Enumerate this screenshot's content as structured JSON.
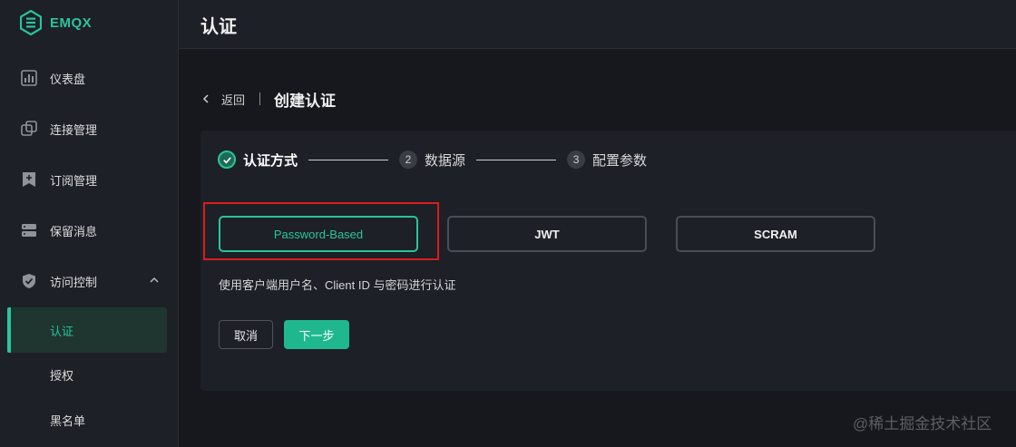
{
  "app": {
    "name": "EMQX"
  },
  "sidebar": {
    "items": [
      {
        "label": "仪表盘",
        "icon": "dashboard-icon"
      },
      {
        "label": "连接管理",
        "icon": "connections-icon"
      },
      {
        "label": "订阅管理",
        "icon": "subscriptions-icon"
      },
      {
        "label": "保留消息",
        "icon": "retained-messages-icon"
      },
      {
        "label": "访问控制",
        "icon": "access-control-icon",
        "expanded": true
      }
    ],
    "subitems": [
      {
        "label": "认证",
        "active": true
      },
      {
        "label": "授权",
        "active": false
      },
      {
        "label": "黑名单",
        "active": false
      }
    ]
  },
  "header": {
    "title": "认证"
  },
  "breadcrumb": {
    "back_label": "返回",
    "title": "创建认证"
  },
  "steps": [
    {
      "number": "1",
      "label": "认证方式",
      "status": "done"
    },
    {
      "number": "2",
      "label": "数据源",
      "status": "pending"
    },
    {
      "number": "3",
      "label": "配置参数",
      "status": "pending"
    }
  ],
  "options": [
    {
      "label": "Password-Based",
      "selected": true
    },
    {
      "label": "JWT",
      "selected": false
    },
    {
      "label": "SCRAM",
      "selected": false
    }
  ],
  "description": "使用客户端用户名、Client ID 与密码进行认证",
  "buttons": {
    "cancel": "取消",
    "next": "下一步"
  },
  "watermark": "@稀土掘金技术社区",
  "colors": {
    "accent": "#2ac49b",
    "highlight_border": "#d81e1e",
    "background": "#16181d"
  }
}
